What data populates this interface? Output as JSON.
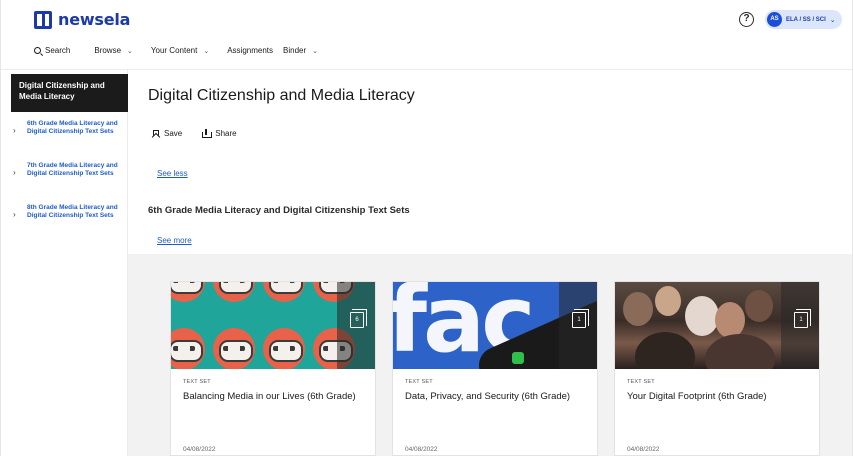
{
  "brand": {
    "name": "newsela"
  },
  "header": {
    "help_icon_text": "?",
    "account_initials": "AS",
    "account_label": "ELA / SS / SCI"
  },
  "nav": {
    "search": "Search",
    "browse": "Browse",
    "your_content": "Your Content",
    "assignments": "Assignments",
    "binder": "Binder"
  },
  "sidebar": {
    "heading": "Digital Citizenship and Media Literacy",
    "items": [
      {
        "label": "6th Grade Media Literacy and Digital Citizenship Text Sets"
      },
      {
        "label": "7th Grade Media Literacy and Digital Citizenship Text Sets"
      },
      {
        "label": "8th Grade Media Literacy and Digital Citizenship Text Sets"
      }
    ]
  },
  "main": {
    "title": "Digital Citizenship and Media Literacy",
    "save": "Save",
    "share": "Share",
    "see_less": "See less",
    "section_title": "6th Grade Media Literacy and Digital Citizenship Text Sets",
    "see_more": "See more"
  },
  "cards": [
    {
      "kind": "TEXT SET",
      "title": "Balancing Media in our Lives (6th Grade)",
      "date": "04/08/2022",
      "count": "6"
    },
    {
      "kind": "TEXT SET",
      "title": "Data, Privacy, and Security (6th Grade)",
      "date": "04/08/2022",
      "count": "1"
    },
    {
      "kind": "TEXT SET",
      "title": "Your Digital Footprint (6th Grade)",
      "date": "04/08/2022",
      "count": "1"
    }
  ],
  "colors": {
    "brand": "#1c3aa9",
    "link": "#1f5cc9",
    "sidebar_active": "#1b1b1b"
  },
  "icons": [
    "logo-icon",
    "help-icon",
    "search-icon",
    "chevron-down-icon",
    "chevron-right-icon",
    "bookmark-icon",
    "share-icon",
    "stack-icon"
  ]
}
